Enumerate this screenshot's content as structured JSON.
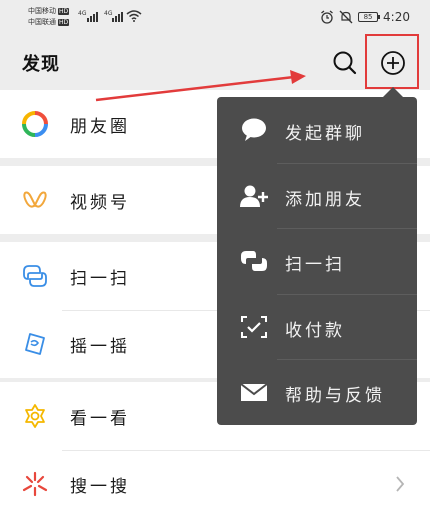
{
  "status_bar": {
    "carrier1": "中国移动",
    "carrier2": "中国联通",
    "hd_badge": "HD",
    "network1": "4G",
    "network2": "4G",
    "battery": "85",
    "time": "4:20"
  },
  "header": {
    "title": "发现"
  },
  "groups": [
    [
      {
        "label": "朋友圈",
        "icon": "moments-icon"
      }
    ],
    [
      {
        "label": "视频号",
        "icon": "channels-icon"
      }
    ],
    [
      {
        "label": "扫一扫",
        "icon": "scan-icon"
      },
      {
        "label": "摇一摇",
        "icon": "shake-icon"
      }
    ],
    [
      {
        "label": "看一看",
        "icon": "top-stories-icon"
      },
      {
        "label": "搜一搜",
        "icon": "search-sparkle-icon"
      }
    ]
  ],
  "popup_menu": {
    "items": [
      {
        "label": "发起群聊",
        "icon": "chat-bubble-icon"
      },
      {
        "label": "添加朋友",
        "icon": "add-friend-icon"
      },
      {
        "label": "扫一扫",
        "icon": "scan-icon"
      },
      {
        "label": "收付款",
        "icon": "payment-icon"
      },
      {
        "label": "帮助与反馈",
        "icon": "mail-icon"
      }
    ]
  },
  "colors": {
    "accent_red": "#e23b3b",
    "popup_bg": "#4c4c4c",
    "page_bg": "#ededed"
  }
}
